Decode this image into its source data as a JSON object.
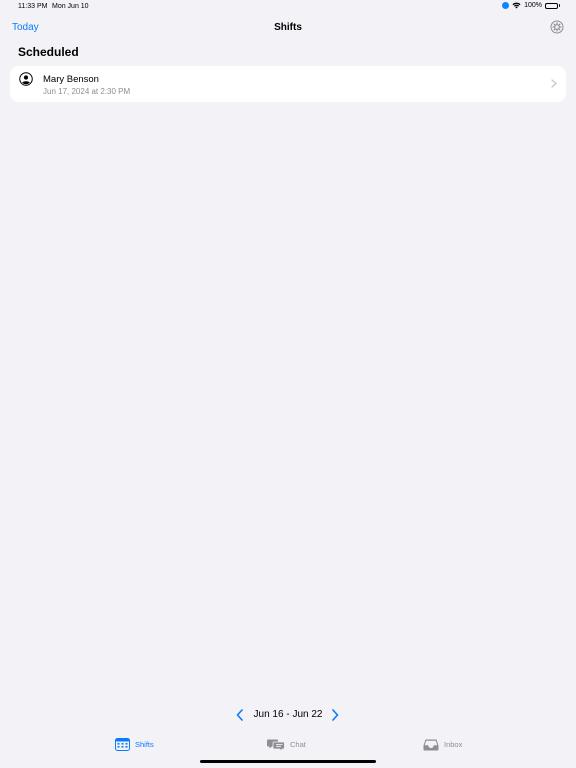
{
  "status_bar": {
    "time": "11:33 PM",
    "date": "Mon Jun 10",
    "battery_percent": "100%",
    "battery_level": 1.0
  },
  "nav": {
    "left_button": "Today",
    "title": "Shifts",
    "right_icon": "gear-circle-icon"
  },
  "section": {
    "title": "Scheduled"
  },
  "shifts": [
    {
      "name": "Mary Benson",
      "datetime": "Jun 17, 2024 at 2:30 PM",
      "icon": "person-circle-icon"
    }
  ],
  "week": {
    "label": "Jun 16 - Jun 22"
  },
  "tabs": [
    {
      "label": "Shifts",
      "icon": "calendar-icon",
      "selected": true
    },
    {
      "label": "Chat",
      "icon": "chat-bubbles-icon",
      "selected": false
    },
    {
      "label": "Inbox",
      "icon": "inbox-tray-icon",
      "selected": false
    }
  ],
  "colors": {
    "accent": "#0a7aff",
    "background": "#f2f2f7",
    "secondary_text": "#8e8e93"
  }
}
